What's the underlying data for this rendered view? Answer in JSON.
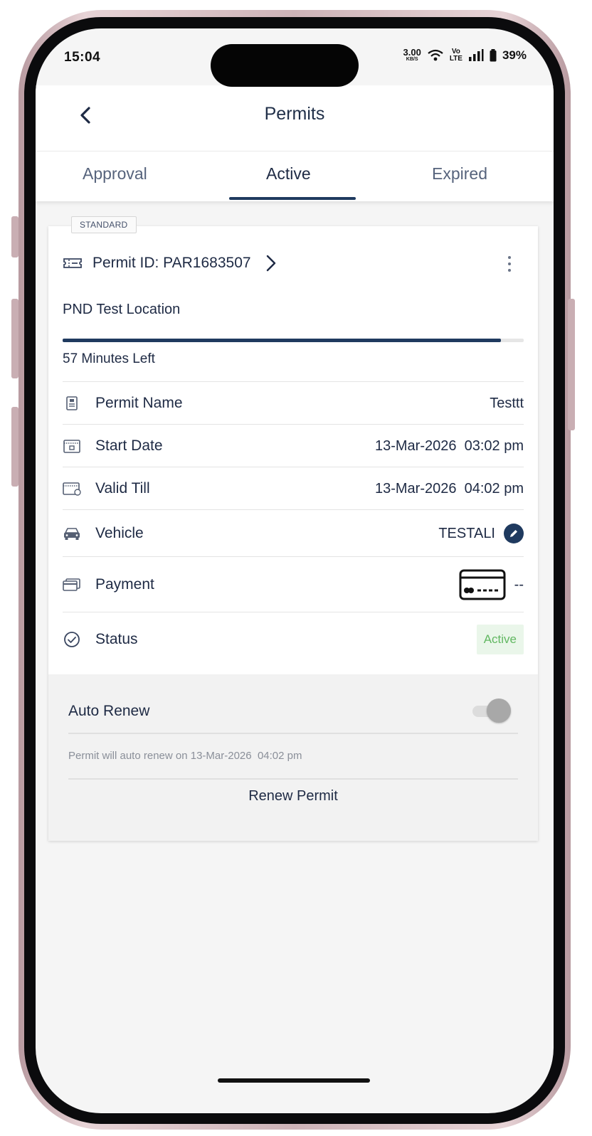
{
  "status_bar": {
    "time": "15:04",
    "speed_value": "3.00",
    "speed_unit": "KB/S",
    "network_top": "Vo",
    "network_bottom": "LTE",
    "battery": "39%"
  },
  "header": {
    "title": "Permits"
  },
  "tabs": [
    {
      "label": "Approval",
      "active": false
    },
    {
      "label": "Active",
      "active": true
    },
    {
      "label": "Expired",
      "active": false
    }
  ],
  "permit": {
    "badge": "STANDARD",
    "permit_id": "Permit ID: PAR1683507",
    "location": "PND Test Location",
    "time_left_fraction": 0.95,
    "time_left": "57 Minutes Left",
    "details": [
      {
        "key": "permit_name",
        "label": "Permit Name",
        "value": "Testtt",
        "icon": "document-icon"
      },
      {
        "key": "start_date",
        "label": "Start Date",
        "value": "13-Mar-2026  03:02 pm",
        "icon": "calendar-icon"
      },
      {
        "key": "valid_till",
        "label": "Valid Till",
        "value": "13-Mar-2026  04:02 pm",
        "icon": "calendar-clock-icon"
      },
      {
        "key": "vehicle",
        "label": "Vehicle",
        "value": "TESTALI",
        "icon": "car-icon"
      },
      {
        "key": "payment",
        "label": "Payment",
        "value": "--",
        "icon": "card-icon"
      },
      {
        "key": "status",
        "label": "Status",
        "value": "Active",
        "icon": "check-circle-icon"
      }
    ]
  },
  "auto_renew": {
    "label": "Auto Renew",
    "enabled": false,
    "note": "Permit will auto renew on 13-Mar-2026  04:02 pm",
    "renew_button": "Renew Permit"
  },
  "colors": {
    "primary": "#1f3a5f",
    "status_active_text": "#62b862",
    "status_active_bg": "#eaf6ea"
  }
}
